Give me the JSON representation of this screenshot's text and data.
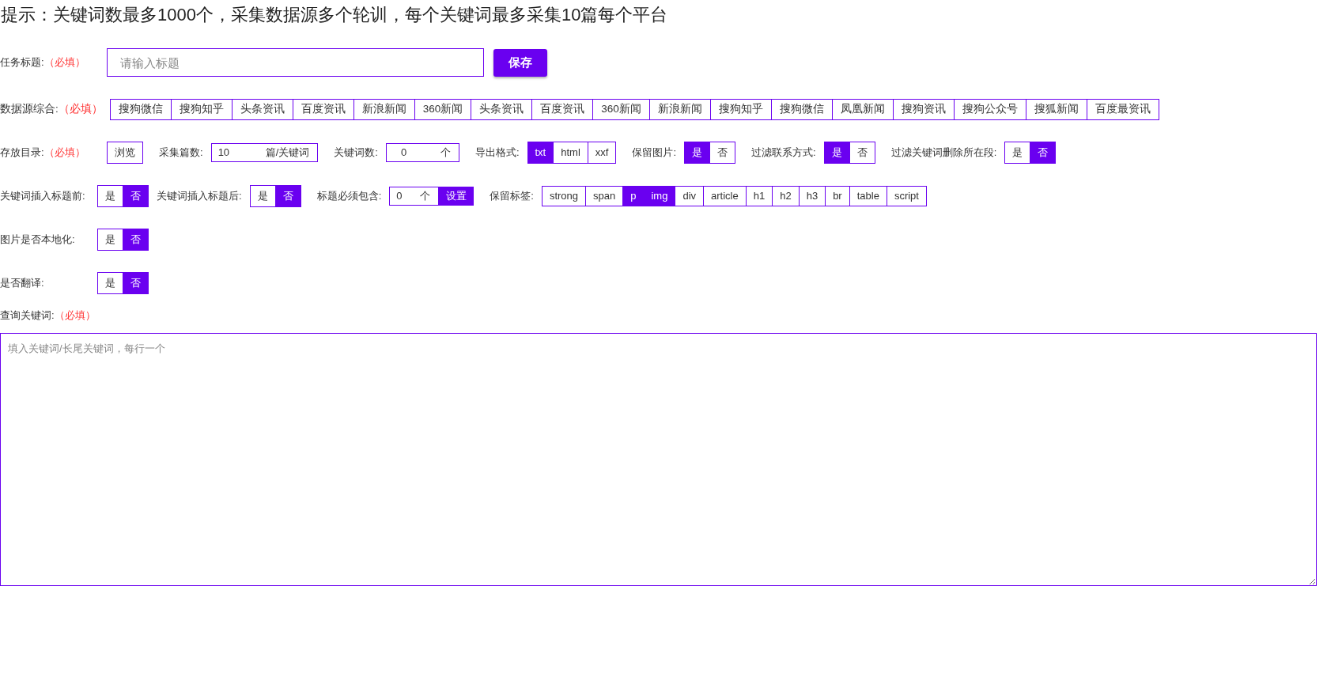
{
  "notice": "提示：关键词数最多1000个，采集数据源多个轮训，每个关键词最多采集10篇每个平台",
  "task_title": {
    "label": "任务标题:",
    "required": "（必填）",
    "placeholder": "请输入标题",
    "button": "保存"
  },
  "sources": {
    "label": "数据源综合:",
    "required": "（必填）",
    "items": [
      {
        "label": "搜狗微信",
        "selected": false
      },
      {
        "label": "搜狗知乎",
        "selected": false
      },
      {
        "label": "头条资讯",
        "selected": false
      },
      {
        "label": "百度资讯",
        "selected": false
      },
      {
        "label": "新浪新闻",
        "selected": false
      },
      {
        "label": "360新闻",
        "selected": false
      },
      {
        "label": "头条资讯",
        "selected": false
      },
      {
        "label": "百度资讯",
        "selected": false
      },
      {
        "label": "360新闻",
        "selected": false
      },
      {
        "label": "新浪新闻",
        "selected": false
      },
      {
        "label": "搜狗知乎",
        "selected": false
      },
      {
        "label": "搜狗微信",
        "selected": false
      },
      {
        "label": "凤凰新闻",
        "selected": false
      },
      {
        "label": "搜狗资讯",
        "selected": false
      },
      {
        "label": "搜狗公众号",
        "selected": false
      },
      {
        "label": "搜狐新闻",
        "selected": false
      },
      {
        "label": "百度最资讯",
        "selected": false
      }
    ]
  },
  "rows": [
    {
      "label": "存放目录:",
      "required": "（必填）",
      "controls": [
        {
          "kind": "button",
          "label": "浏览"
        },
        {
          "kind": "caption",
          "text": "采集篇数:"
        },
        {
          "kind": "number",
          "value": "10",
          "unit": "篇/关键词"
        },
        {
          "kind": "caption",
          "text": "关键词数:"
        },
        {
          "kind": "number",
          "value": "0",
          "unit": "个"
        },
        {
          "kind": "caption",
          "text": "导出格式:"
        },
        {
          "kind": "segmented",
          "options": [
            {
              "label": "txt",
              "selected": true
            },
            {
              "label": "html",
              "selected": false
            },
            {
              "label": "xxf",
              "selected": false
            }
          ]
        },
        {
          "kind": "caption",
          "text": "保留图片:"
        },
        {
          "kind": "segmented",
          "options": [
            {
              "label": "是",
              "selected": true
            },
            {
              "label": "否",
              "selected": false
            }
          ]
        },
        {
          "kind": "caption",
          "text": "过滤联系方式:"
        },
        {
          "kind": "segmented",
          "options": [
            {
              "label": "是",
              "selected": true
            },
            {
              "label": "否",
              "selected": false
            }
          ]
        },
        {
          "kind": "caption",
          "text": "过滤关键词删除所在段:"
        },
        {
          "kind": "segmented",
          "options": [
            {
              "label": "是",
              "selected": false
            },
            {
              "label": "否",
              "selected": true
            }
          ]
        }
      ]
    },
    {
      "label": "关键词插入标题前:",
      "controls": [
        {
          "kind": "segmented",
          "options": [
            {
              "label": "是",
              "selected": false
            },
            {
              "label": "否",
              "selected": true
            }
          ]
        },
        {
          "kind": "caption",
          "text": "关键词插入标题后:"
        },
        {
          "kind": "segmented",
          "options": [
            {
              "label": "是",
              "selected": false
            },
            {
              "label": "否",
              "selected": true
            }
          ]
        },
        {
          "kind": "caption",
          "text": "标题必须包含:"
        },
        {
          "kind": "number",
          "value": "0",
          "unit": "个",
          "attached": "设置"
        },
        {
          "kind": "caption",
          "text": "保留标签:"
        },
        {
          "kind": "segmented",
          "options": [
            {
              "label": "strong",
              "selected": false
            },
            {
              "label": "span",
              "selected": false
            },
            {
              "label": "p",
              "selected": true
            },
            {
              "label": "img",
              "selected": true
            },
            {
              "label": "div",
              "selected": false
            },
            {
              "label": "article",
              "selected": false
            },
            {
              "label": "h1",
              "selected": false
            },
            {
              "label": "h2",
              "selected": false
            },
            {
              "label": "h3",
              "selected": false
            },
            {
              "label": "br",
              "selected": false
            },
            {
              "label": "table",
              "selected": false
            },
            {
              "label": "script",
              "selected": false
            }
          ]
        }
      ]
    },
    {
      "label": "图片是否本地化:",
      "controls": [
        {
          "kind": "segmented",
          "options": [
            {
              "label": "是",
              "selected": false
            },
            {
              "label": "否",
              "selected": true
            }
          ]
        }
      ]
    },
    {
      "label": "是否翻译:",
      "controls": [
        {
          "kind": "segmented",
          "options": [
            {
              "label": "是",
              "selected": false
            },
            {
              "label": "否",
              "selected": true
            }
          ]
        }
      ]
    }
  ],
  "keywords": {
    "label": "查询关键词:",
    "required": "（必填）",
    "placeholder": "填入关键词/长尾关键词，每行一个"
  }
}
